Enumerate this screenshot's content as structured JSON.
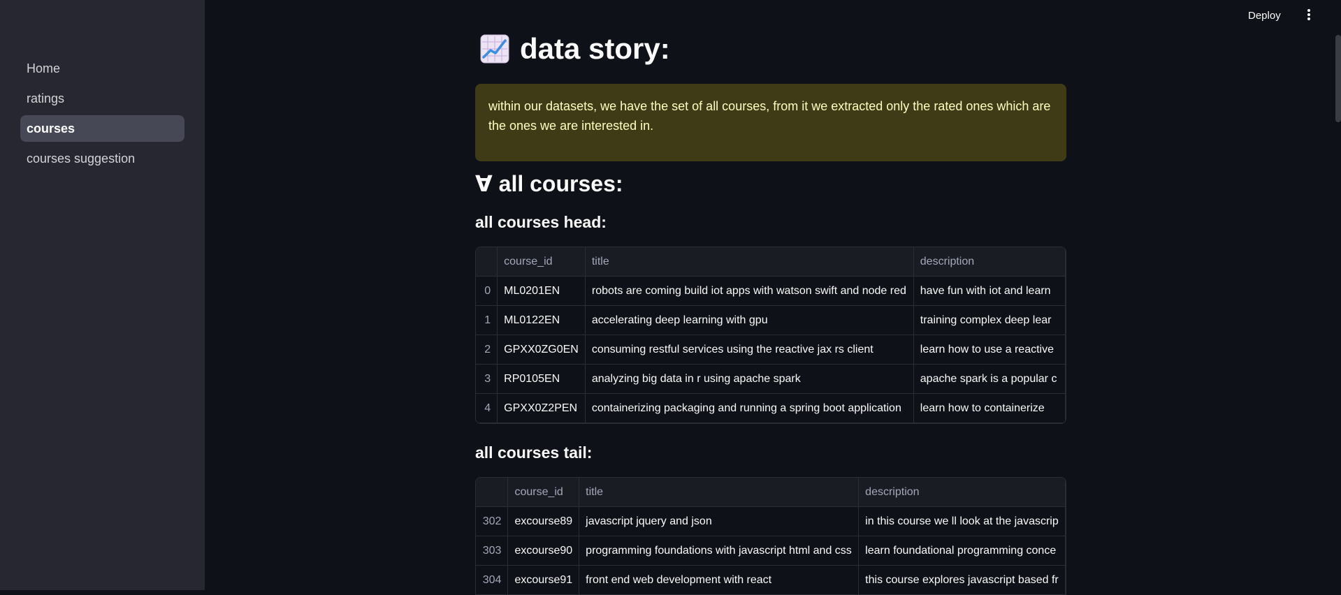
{
  "sidebar": {
    "items": [
      {
        "label": "Home",
        "active": false
      },
      {
        "label": "ratings",
        "active": false
      },
      {
        "label": "courses",
        "active": true
      },
      {
        "label": "courses suggestion",
        "active": false
      }
    ]
  },
  "topbar": {
    "deploy_label": "Deploy",
    "menu_icon": "kebab-menu-icon"
  },
  "page": {
    "title_icon": "chart-increasing-icon",
    "title": "data story:",
    "callout": "within our datasets, we have the set of all courses, from it we extracted only the rated ones which are the ones we are interested in.",
    "callout_color": "#3e3b16",
    "section_all": "∀ all courses:",
    "head_heading": "all courses head:",
    "tail_heading": "all courses tail:"
  },
  "head_table": {
    "columns": [
      "",
      "course_id",
      "title",
      "description"
    ],
    "rows": [
      [
        "0",
        "ML0201EN",
        "robots are coming  build iot apps with watson  swift  and node red",
        "have fun with iot and learn"
      ],
      [
        "1",
        "ML0122EN",
        "accelerating deep learning with gpu",
        "training complex deep lear"
      ],
      [
        "2",
        "GPXX0ZG0EN",
        "consuming restful services using the reactive jax rs client",
        "learn how to use a reactive"
      ],
      [
        "3",
        "RP0105EN",
        "analyzing big data in r using apache spark",
        "apache spark is a popular c"
      ],
      [
        "4",
        "GPXX0Z2PEN",
        "containerizing  packaging  and running a spring boot application",
        "learn how to containerize"
      ]
    ]
  },
  "tail_table": {
    "columns": [
      "",
      "course_id",
      "title",
      "description"
    ],
    "rows": [
      [
        "302",
        "excourse89",
        "javascript  jquery  and json",
        "in this course  we ll look at the javascrip"
      ],
      [
        "303",
        "excourse90",
        "programming foundations with javascript  html and css",
        "learn foundational programming conce"
      ],
      [
        "304",
        "excourse91",
        "front end web development with react",
        "this course explores javascript based fr"
      ]
    ]
  }
}
